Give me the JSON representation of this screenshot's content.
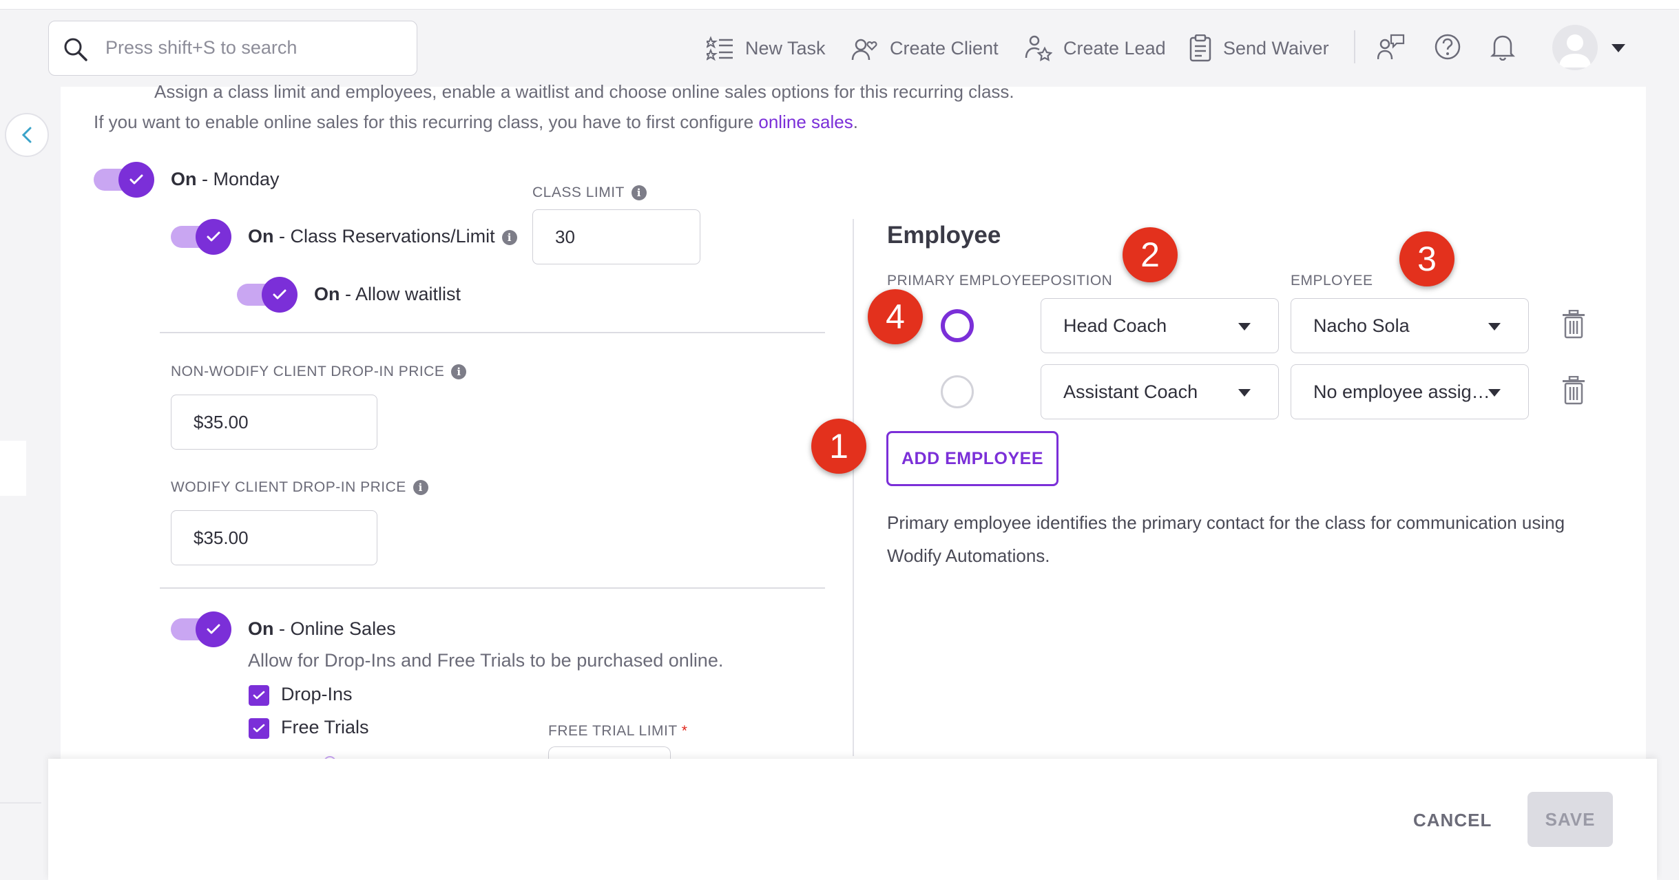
{
  "header": {
    "search_placeholder": "Press shift+S to search",
    "actions": {
      "new_task": "New Task",
      "create_client": "Create Client",
      "create_lead": "Create Lead",
      "send_waiver": "Send Waiver"
    }
  },
  "intro": {
    "line1": "Assign a class limit and employees, enable a waitlist and choose online sales options for this recurring class.",
    "line2_prefix": "If you want to enable online sales for this recurring class, you have to first configure ",
    "line2_link": "online sales",
    "line2_suffix": "."
  },
  "schedule": {
    "day_toggle": {
      "state": "On",
      "label": " - Monday"
    },
    "reservations_toggle": {
      "state": "On",
      "label": " - Class Reservations/Limit"
    },
    "waitlist_toggle": {
      "state": "On",
      "label": " - Allow waitlist"
    },
    "class_limit_label": "CLASS LIMIT",
    "class_limit_value": "30"
  },
  "pricing": {
    "non_wodify_label": "NON-WODIFY CLIENT DROP-IN PRICE",
    "non_wodify_value": "$35.00",
    "wodify_label": "WODIFY CLIENT DROP-IN PRICE",
    "wodify_value": "$35.00"
  },
  "online_sales": {
    "toggle_state": "On",
    "toggle_label": " - Online Sales",
    "description": "Allow for Drop-Ins and Free Trials to be purchased online.",
    "dropins_label": "Drop-Ins",
    "free_trials_label": "Free Trials",
    "free_trial_limit_label": "FREE TRIAL LIMIT",
    "required_mark": "*"
  },
  "employee_panel": {
    "title": "Employee",
    "col_primary": "PRIMARY EMPLOYEE",
    "col_position": "POSITION",
    "col_employee": "EMPLOYEE",
    "rows": [
      {
        "position": "Head Coach",
        "employee": "Nacho Sola",
        "primary": true
      },
      {
        "position": "Assistant Coach",
        "employee": "No employee assigned",
        "primary": false
      }
    ],
    "add_button": "ADD EMPLOYEE",
    "note_line1": "Primary employee identifies the primary contact for the class for communication using",
    "note_line2": "Wodify Automations."
  },
  "markers": [
    "1",
    "2",
    "3",
    "4"
  ],
  "footer": {
    "cancel": "CANCEL",
    "save": "SAVE"
  },
  "colors": {
    "accent": "#7b2fd8",
    "toggle_track": "#c9a6f2",
    "marker": "#e3311d"
  }
}
